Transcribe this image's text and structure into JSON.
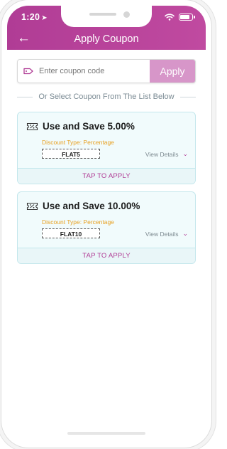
{
  "status_bar": {
    "time": "1:20",
    "location_glyph": "➤"
  },
  "header": {
    "back_icon": "←",
    "title": "Apply Coupon"
  },
  "coupon_entry": {
    "placeholder": "Enter coupon code",
    "value": "",
    "apply_label": "Apply"
  },
  "divider_text": "Or Select Coupon From The List Below",
  "coupons": [
    {
      "title": "Use and Save 5.00%",
      "discount_type": "Discount Type: Percentage",
      "code": "FLAT5",
      "view_details": "View Details",
      "chevron": "⌄",
      "tap_label": "TAP TO APPLY"
    },
    {
      "title": "Use and Save 10.00%",
      "discount_type": "Discount Type: Percentage",
      "code": "FLAT10",
      "view_details": "View Details",
      "chevron": "⌄",
      "tap_label": "TAP TO APPLY"
    }
  ],
  "colors": {
    "accent": "#b03c95",
    "apply_button": "#d796c9",
    "card_bg": "#f1fbfc",
    "card_border": "#c4e7ec",
    "discount_type": "#e8a020"
  },
  "icons": {
    "back": "arrow-left-icon",
    "location": "location-arrow-icon",
    "wifi": "wifi-icon",
    "battery": "battery-icon",
    "coupon_tag": "tag-icon",
    "ticket": "coupon-ticket-icon",
    "chevron": "chevron-down-icon"
  },
  "battery_level": 0.85
}
